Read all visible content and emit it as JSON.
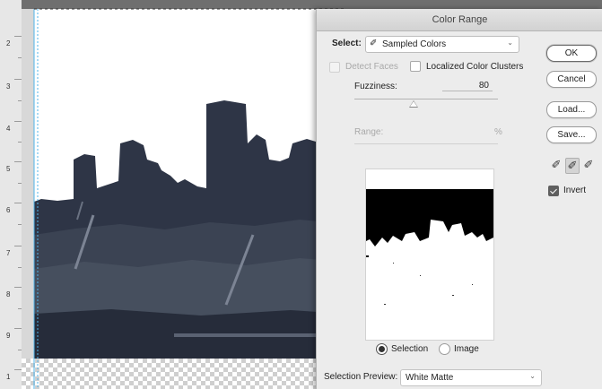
{
  "ruler": {
    "labels": [
      "2",
      "3",
      "4",
      "5",
      "6",
      "7",
      "8",
      "9",
      "1"
    ]
  },
  "dialog": {
    "title": "Color Range",
    "select_label": "Select:",
    "select_value": "Sampled Colors",
    "detect_faces_label": "Detect Faces",
    "localized_label": "Localized Color Clusters",
    "fuzziness_label": "Fuzziness:",
    "fuzziness_value": "80",
    "range_label": "Range:",
    "range_unit": "%",
    "selection_label": "Selection",
    "image_label": "Image",
    "preview_label": "Selection Preview:",
    "preview_value": "White Matte",
    "invert_label": "Invert",
    "buttons": {
      "ok": "OK",
      "cancel": "Cancel",
      "load": "Load...",
      "save": "Save..."
    },
    "state": {
      "localized_checked": false,
      "detect_faces_enabled": false,
      "invert_checked": true,
      "view_mode": "Selection",
      "active_eyedropper": "add-to-sample",
      "fuzziness_slider_fraction": 0.38
    }
  },
  "icons": [
    "eyedropper-icon",
    "eyedropper-plus-icon",
    "eyedropper-minus-icon",
    "chevron-down-icon"
  ],
  "colors": {
    "dialog_bg": "#ececec",
    "city_dark": "#2c3444",
    "sky": "#ffffff",
    "mask_black": "#000000"
  }
}
